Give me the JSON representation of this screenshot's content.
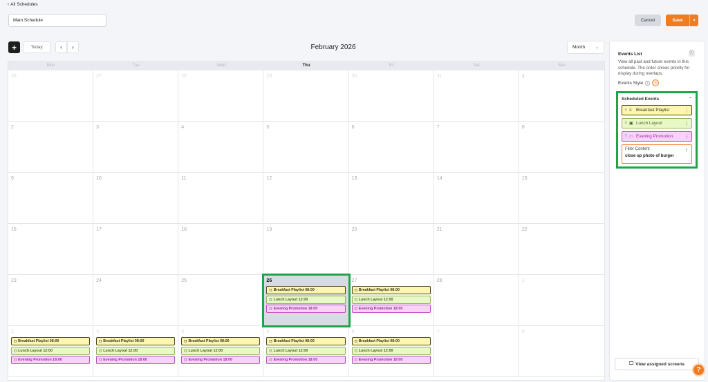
{
  "nav": {
    "back_label": "All Schedules"
  },
  "schedule": {
    "name": "Main Schedule"
  },
  "header": {
    "cancel_label": "Cancel",
    "save_label": "Save"
  },
  "toolbar": {
    "add_label": "+",
    "today_label": "Today",
    "month_title": "February 2026",
    "view_value": "Month"
  },
  "calendar": {
    "weekdays": [
      "Mon",
      "Tue",
      "Wed",
      "Thu",
      "Fri",
      "Sat",
      "Sun"
    ],
    "today_weekday_index": 3,
    "weeks": [
      [
        {
          "d": "26",
          "m": true
        },
        {
          "d": "27",
          "m": true
        },
        {
          "d": "28",
          "m": true
        },
        {
          "d": "29",
          "m": true
        },
        {
          "d": "30",
          "m": true
        },
        {
          "d": "31",
          "m": true
        },
        {
          "d": "1",
          "m": false
        }
      ],
      [
        {
          "d": "2",
          "m": false
        },
        {
          "d": "3",
          "m": false
        },
        {
          "d": "4",
          "m": false
        },
        {
          "d": "5",
          "m": false
        },
        {
          "d": "6",
          "m": false
        },
        {
          "d": "7",
          "m": false
        },
        {
          "d": "8",
          "m": false
        }
      ],
      [
        {
          "d": "9",
          "m": false
        },
        {
          "d": "10",
          "m": false
        },
        {
          "d": "11",
          "m": false
        },
        {
          "d": "12",
          "m": false
        },
        {
          "d": "13",
          "m": false
        },
        {
          "d": "14",
          "m": false
        },
        {
          "d": "15",
          "m": false
        }
      ],
      [
        {
          "d": "16",
          "m": false
        },
        {
          "d": "17",
          "m": false
        },
        {
          "d": "18",
          "m": false
        },
        {
          "d": "19",
          "m": false
        },
        {
          "d": "20",
          "m": false
        },
        {
          "d": "21",
          "m": false
        },
        {
          "d": "22",
          "m": false
        }
      ],
      [
        {
          "d": "23",
          "m": false
        },
        {
          "d": "24",
          "m": false
        },
        {
          "d": "25",
          "m": false
        },
        {
          "d": "26",
          "m": false,
          "hl": true,
          "ev": true
        },
        {
          "d": "27",
          "m": false,
          "ev": true
        },
        {
          "d": "28",
          "m": false
        },
        {
          "d": "1",
          "m": true
        }
      ],
      [
        {
          "d": "2",
          "m": true,
          "ev": true
        },
        {
          "d": "3",
          "m": true,
          "ev": true
        },
        {
          "d": "4",
          "m": true,
          "ev": true
        },
        {
          "d": "5",
          "m": true,
          "ev": true
        },
        {
          "d": "6",
          "m": true,
          "ev": true
        },
        {
          "d": "7",
          "m": true
        },
        {
          "d": "8",
          "m": true
        }
      ]
    ],
    "cell_events": [
      {
        "cls": "bf",
        "label": "Breakfast Playlist 08:00"
      },
      {
        "cls": "lu",
        "label": "Lunch Layout 12:00"
      },
      {
        "cls": "ep",
        "label": "Evening Promotion 18:00"
      }
    ]
  },
  "sidebar": {
    "title": "Events List",
    "description": "View all past and future events in this schedule. The order shows priority for display during overlaps.",
    "events_style_label": "Events Style",
    "scheduled_title": "Scheduled Events",
    "items": [
      {
        "cls": "bf",
        "label": "Breakfast Playlist",
        "icon": "playlist-icon"
      },
      {
        "cls": "lu",
        "label": "Lunch Layout",
        "icon": "layout-icon"
      },
      {
        "cls": "ep",
        "label": "Evening Promotion",
        "icon": "video-icon"
      }
    ],
    "filler_title": "Filler Content",
    "filler_value": "close up photo of burger",
    "view_screens_label": "View assigned screens"
  },
  "colors": {
    "accent": "#f07c22",
    "highlight_outline": "#22a34a"
  }
}
